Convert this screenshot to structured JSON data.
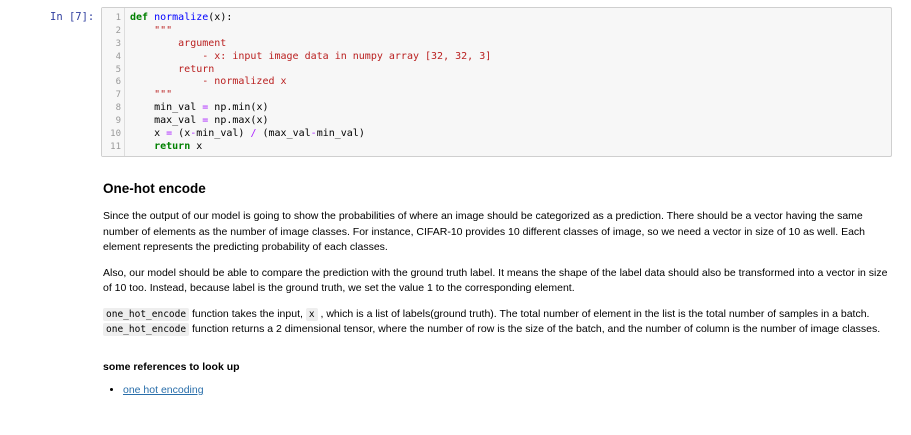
{
  "cell": {
    "prompt": "In [7]:",
    "lines": [
      {
        "n": "1",
        "html": "<span class=\"kw\">def</span> <span class=\"def\">normalize</span>(x):"
      },
      {
        "n": "2",
        "html": "    <span class=\"str\">\"\"\"</span>"
      },
      {
        "n": "3",
        "html": "<span class=\"str\">        argument</span>"
      },
      {
        "n": "4",
        "html": "<span class=\"str\">            - x: input image data in numpy array [32, 32, 3]</span>"
      },
      {
        "n": "5",
        "html": "<span class=\"str\">        return</span>"
      },
      {
        "n": "6",
        "html": "<span class=\"str\">            - normalized x</span>"
      },
      {
        "n": "7",
        "html": "<span class=\"str\">    \"\"\"</span>"
      },
      {
        "n": "8",
        "html": "    min_val <span class=\"op\">=</span> np.min(x)"
      },
      {
        "n": "9",
        "html": "    max_val <span class=\"op\">=</span> np.max(x)"
      },
      {
        "n": "10",
        "html": "    x <span class=\"op\">=</span> (x<span class=\"op\">-</span>min_val) <span class=\"op\">/</span> (max_val<span class=\"op\">-</span>min_val)"
      },
      {
        "n": "11",
        "html": "    <span class=\"kw\">return</span> x"
      }
    ]
  },
  "markdown": {
    "heading": "One-hot encode",
    "p1": "Since the output of our model is going to show the probabilities of where an image should be categorized as a prediction. There should be a vector having the same number of elements as the number of image classes. For instance, CIFAR-10 provides 10 different classes of image, so we need a vector in size of 10 as well. Each element represents the predicting probability of each classes.",
    "p2": "Also, our model should be able to compare the prediction with the ground truth label. It means the shape of the label data should also be transformed into a vector in size of 10 too. Instead, because label is the ground truth, we set the value 1 to the corresponding element.",
    "p3": {
      "code1": "one_hot_encode",
      "t1": " function takes the input, ",
      "code2": "x",
      "t2": " , which is a list of labels(ground truth). The total number of element in the list is the total number of samples in a batch. ",
      "code3": "one_hot_encode",
      "t3": " function returns a 2 dimensional tensor, where the number of row is the size of the batch, and the number of column is the number of image classes."
    },
    "refs_heading": "some references to look up",
    "refs": [
      {
        "label": "one hot encoding"
      }
    ]
  }
}
